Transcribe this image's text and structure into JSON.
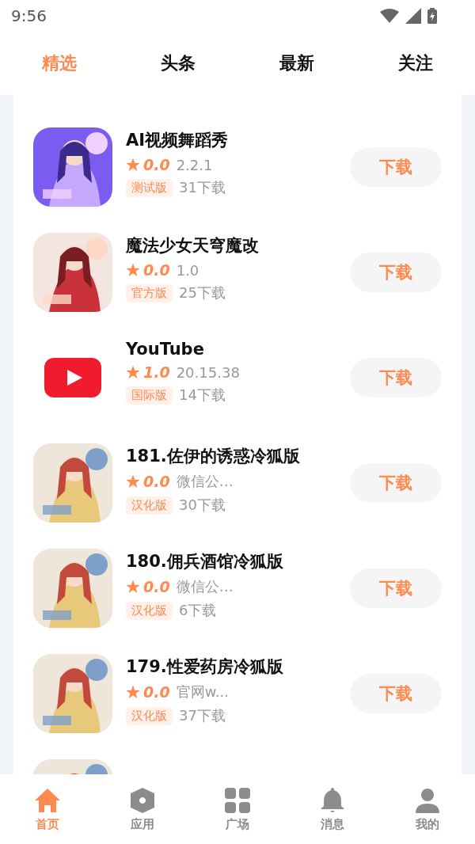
{
  "status_bar": {
    "time": "9:56"
  },
  "tabs": [
    {
      "label": "精选",
      "selected": true
    },
    {
      "label": "头条",
      "selected": false
    },
    {
      "label": "最新",
      "selected": false
    },
    {
      "label": "关注",
      "selected": false
    }
  ],
  "apps": [
    {
      "icon": {
        "kind": "picture"
      },
      "name": "AI视频舞蹈秀",
      "rating": "0.0",
      "version": "2.2.1",
      "tag": "测试版",
      "downloads": "31下载",
      "button": "下载"
    },
    {
      "icon": {
        "kind": "picture"
      },
      "name": "魔法少女天穹魔改",
      "rating": "0.0",
      "version": "1.0",
      "tag": "官方版",
      "downloads": "25下载",
      "button": "下载"
    },
    {
      "icon": {
        "kind": "logo"
      },
      "name": "YouTube",
      "rating": "1.0",
      "version": "20.15.38",
      "tag": "国际版",
      "downloads": "14下载",
      "button": "下载"
    },
    {
      "icon": {
        "kind": "picture"
      },
      "name": "181.佐伊的诱惑冷狐版",
      "rating": "0.0",
      "version": "微信公…",
      "tag": "汉化版",
      "downloads": "30下载",
      "button": "下载"
    },
    {
      "icon": {
        "kind": "picture"
      },
      "name": "180.佣兵酒馆冷狐版",
      "rating": "0.0",
      "version": "微信公…",
      "tag": "汉化版",
      "downloads": "6下载",
      "button": "下载"
    },
    {
      "icon": {
        "kind": "picture"
      },
      "name": "179.性爱药房冷狐版",
      "rating": "0.0",
      "version": "官网w...",
      "tag": "汉化版",
      "downloads": "37下载",
      "button": "下载"
    },
    {
      "icon": {
        "kind": "picture"
      }
    }
  ],
  "bottom_nav": [
    {
      "label": "首页",
      "selected": true
    },
    {
      "label": "应用",
      "selected": false
    },
    {
      "label": "广场",
      "selected": false
    },
    {
      "label": "消息",
      "selected": false
    },
    {
      "label": "我的",
      "selected": false
    }
  ]
}
